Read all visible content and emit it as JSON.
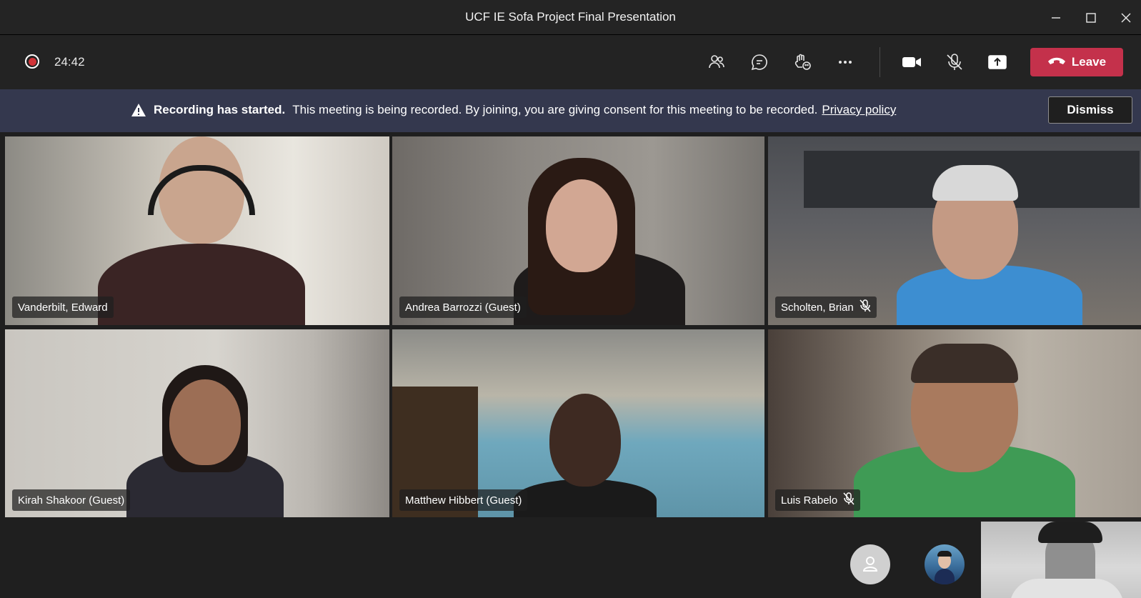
{
  "window": {
    "title": "UCF IE Sofa Project Final Presentation",
    "controls": [
      "minimize-icon",
      "maximize-icon",
      "close-icon"
    ]
  },
  "toolbar": {
    "timer": "24:42",
    "buttons": [
      "people-icon",
      "chat-icon",
      "reactions-icon",
      "more-icon",
      "camera-icon",
      "mic-off-icon",
      "share-icon"
    ],
    "leave_label": "Leave",
    "leave_color": "#c4314b"
  },
  "banner": {
    "bold_text": "Recording has started.",
    "message": "This meeting is being recorded. By joining, you are giving consent for this meeting to be recorded.",
    "link_text": "Privacy policy",
    "dismiss_label": "Dismiss",
    "background": "#34384e"
  },
  "participants": [
    {
      "name": "Vanderbilt, Edward",
      "muted": false
    },
    {
      "name": "Andrea Barrozzi (Guest)",
      "muted": false
    },
    {
      "name": "Scholten, Brian",
      "muted": true
    },
    {
      "name": "Kirah Shakoor (Guest)",
      "muted": false
    },
    {
      "name": "Matthew Hibbert (Guest)",
      "muted": false
    },
    {
      "name": "Luis Rabelo",
      "muted": true
    }
  ],
  "bottom": {
    "overflow_avatars": [
      "generic-person-icon",
      "profile-photo"
    ],
    "self_view": "camera-preview"
  }
}
